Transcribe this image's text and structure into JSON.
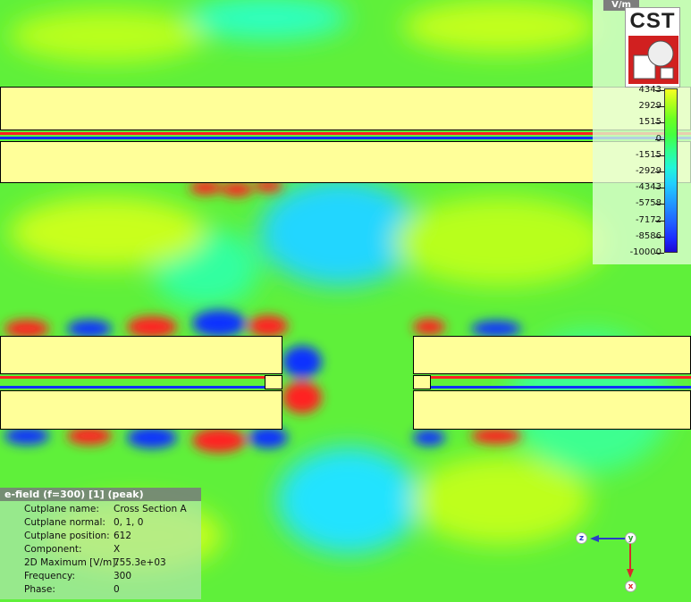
{
  "legend": {
    "unit": "V/m",
    "logo_text": "CST",
    "ticks": [
      "4343",
      "2929",
      "1515",
      "0",
      "-1515",
      "-2929",
      "-4343",
      "-5758",
      "-7172",
      "-8586",
      "-10000"
    ]
  },
  "info_panel": {
    "title": "e-field (f=300) [1] (peak)",
    "rows": [
      {
        "label": "Cutplane name:",
        "value": "Cross Section A"
      },
      {
        "label": "Cutplane normal:",
        "value": "0, 1, 0"
      },
      {
        "label": "Cutplane position:",
        "value": "612"
      },
      {
        "label": "Component:",
        "value": "X"
      },
      {
        "label": "2D Maximum [V/m]:",
        "value": "755.3e+03"
      },
      {
        "label": "Frequency:",
        "value": "300"
      },
      {
        "label": "Phase:",
        "value": "0"
      }
    ]
  },
  "axes": {
    "z": "z",
    "y": "y",
    "x": "x"
  },
  "colors": {
    "structure": "#ffff99",
    "background": "#5ff03a",
    "positive": "#ff2020",
    "negative": "#1030ff"
  }
}
